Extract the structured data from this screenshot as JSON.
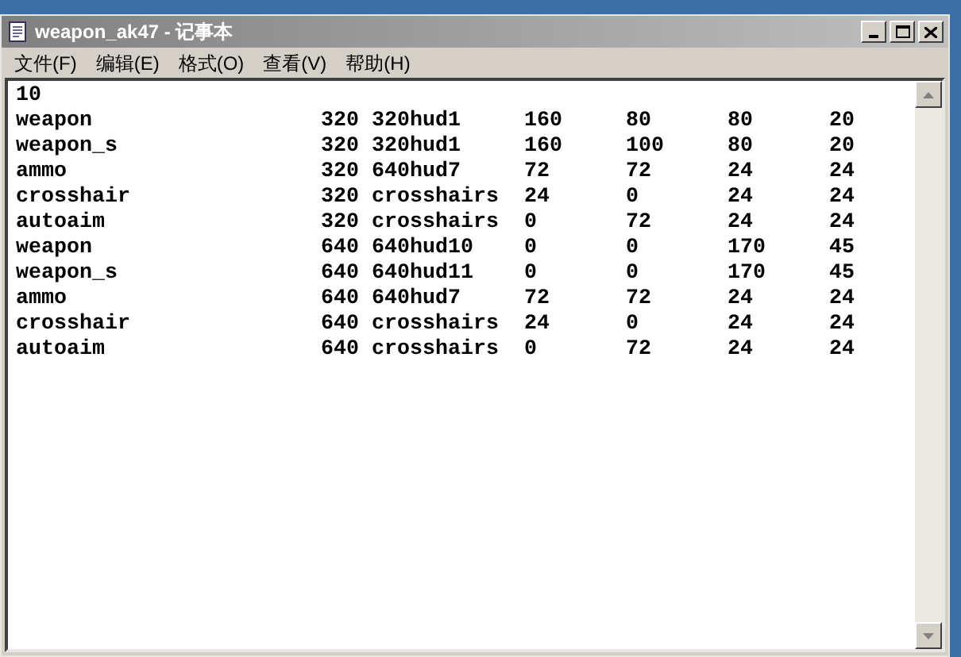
{
  "window": {
    "title": "weapon_ak47 - 记事本"
  },
  "menu": [
    "文件(F)",
    "编辑(E)",
    "格式(O)",
    "查看(V)",
    "帮助(H)"
  ],
  "document": {
    "first_line": "10",
    "rows": [
      [
        "weapon",
        "320",
        "320hud1",
        "160",
        "80",
        "80",
        "20"
      ],
      [
        "weapon_s",
        "320",
        "320hud1",
        "160",
        "100",
        "80",
        "20"
      ],
      [
        "ammo",
        "320",
        "640hud7",
        "72",
        "72",
        "24",
        "24"
      ],
      [
        "crosshair",
        "320",
        "crosshairs",
        "24",
        "0",
        "24",
        "24"
      ],
      [
        "autoaim",
        "320",
        "crosshairs",
        "0",
        "72",
        "24",
        "24"
      ],
      [
        "weapon",
        "640",
        "640hud10",
        "0",
        "0",
        "170",
        "45"
      ],
      [
        "weapon_s",
        "640",
        "640hud11",
        "0",
        "0",
        "170",
        "45"
      ],
      [
        "ammo",
        "640",
        "640hud7",
        "72",
        "72",
        "24",
        "24"
      ],
      [
        "crosshair",
        "640",
        "crosshairs",
        "24",
        "0",
        "24",
        "24"
      ],
      [
        "autoaim",
        "640",
        "crosshairs",
        "0",
        "72",
        "24",
        "24"
      ]
    ]
  }
}
